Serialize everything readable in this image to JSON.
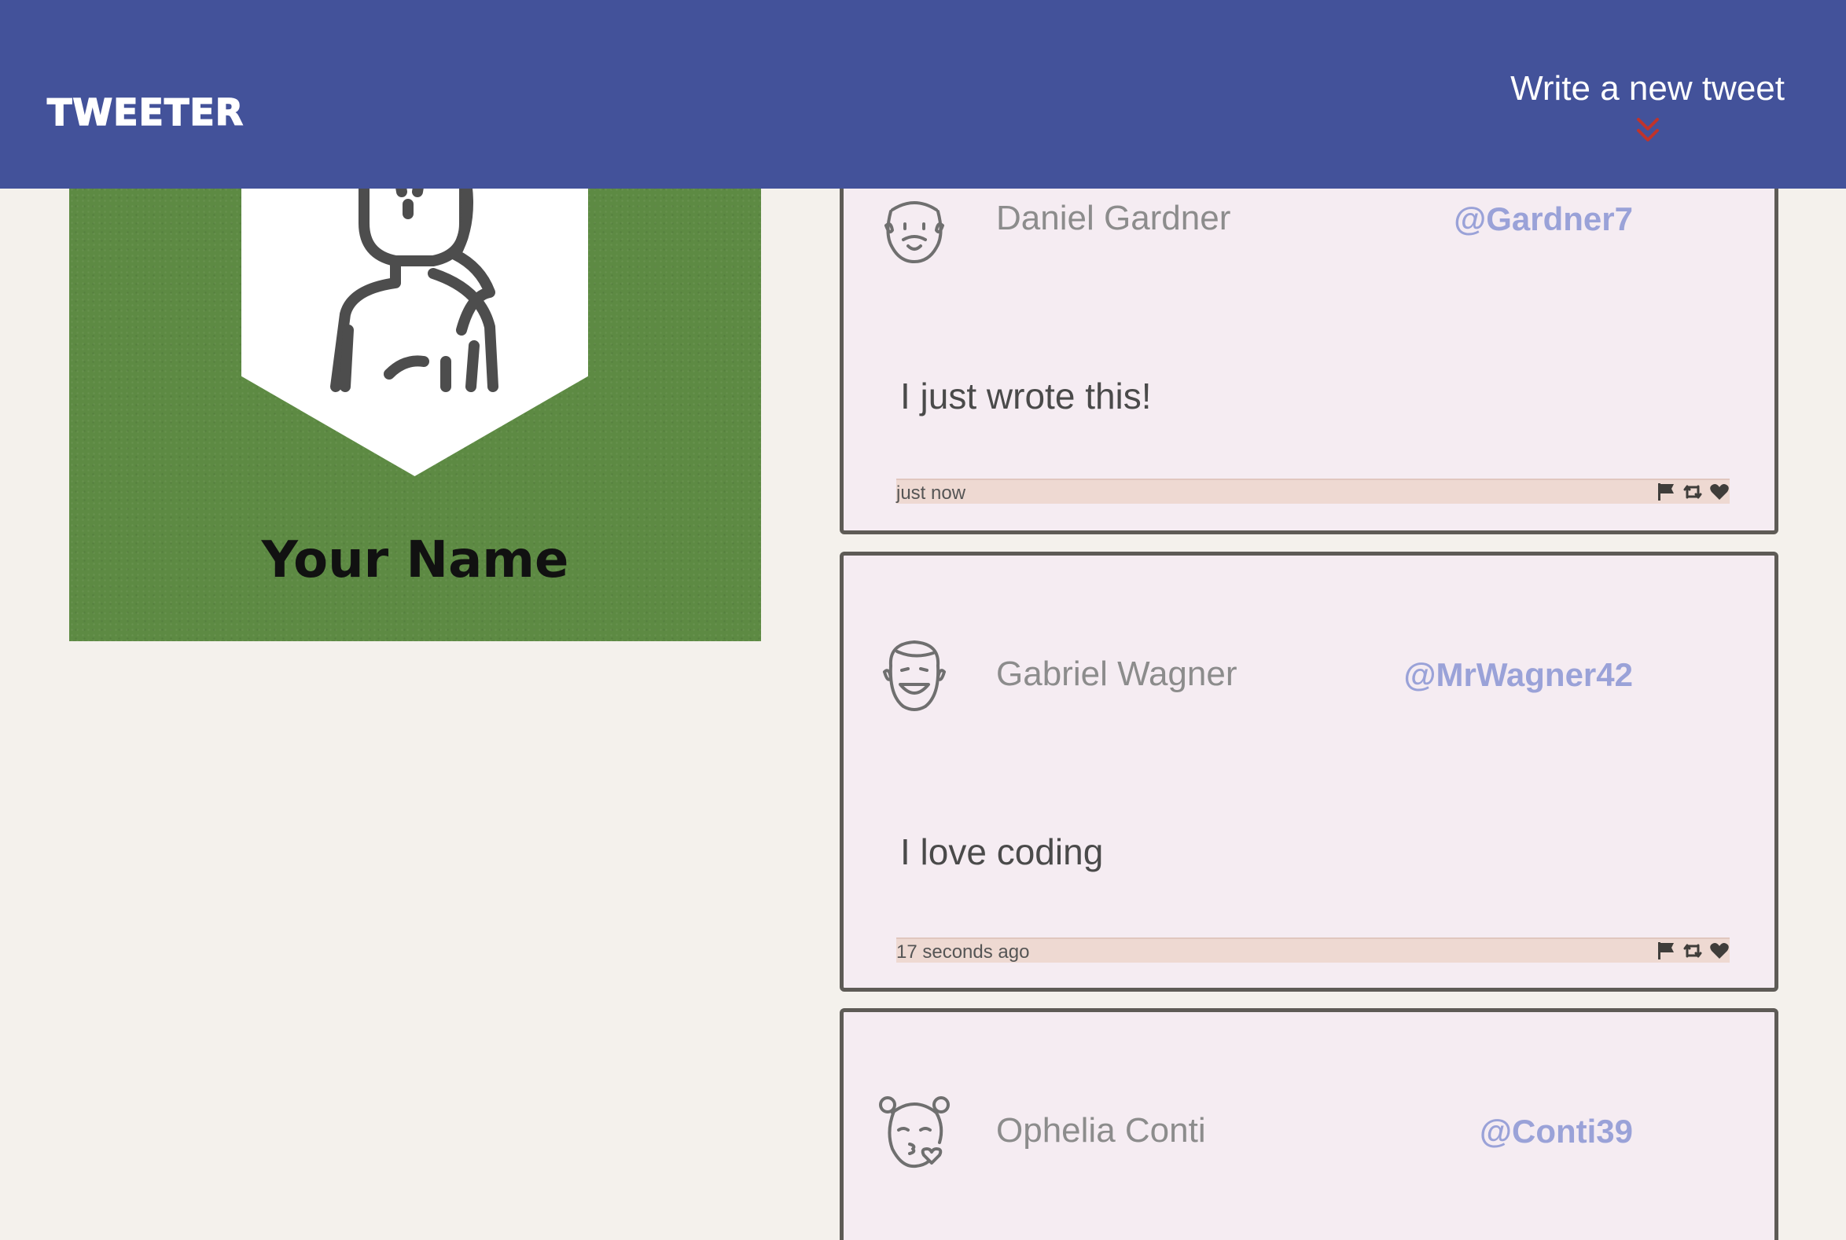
{
  "header": {
    "logo": "TWEETER",
    "compose_label": "Write a new tweet",
    "compose_arrow_icon": "double-chevron-down-icon",
    "background_color": "#43529a",
    "arrow_color": "#c0332b"
  },
  "profile": {
    "name": "Your Name",
    "avatar_icon": "user-avatar-icon",
    "background_color": "#5d8a43"
  },
  "tweets": [
    {
      "name": "Daniel Gardner",
      "handle": "@Gardner7",
      "text": "I just wrote this!",
      "time": "just now",
      "avatar_icon": "bearded-face-avatar-icon"
    },
    {
      "name": "Gabriel Wagner",
      "handle": "@MrWagner42",
      "text": "I love coding",
      "time": "17 seconds ago",
      "avatar_icon": "smiling-face-avatar-icon"
    },
    {
      "name": "Ophelia Conti",
      "handle": "@Conti39",
      "text": "",
      "time": "",
      "avatar_icon": "kissing-face-avatar-icon"
    }
  ],
  "tweet_actions": [
    "flag-icon",
    "retweet-icon",
    "heart-icon"
  ]
}
